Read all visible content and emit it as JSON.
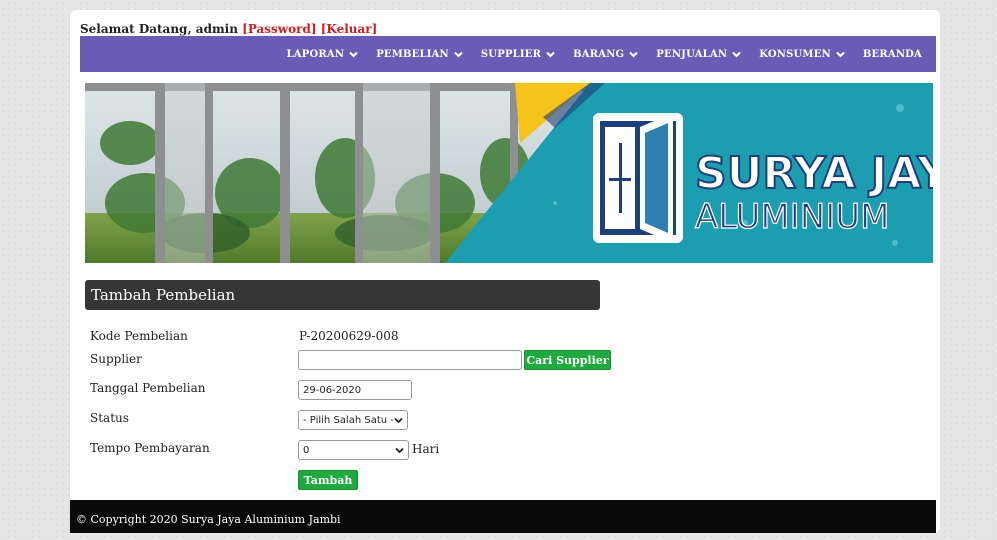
{
  "header": {
    "welcome_text": "Selamat Datang, admin",
    "password_link": "[Password]",
    "logout_link": "[Keluar]"
  },
  "nav": {
    "items": [
      "LAPORAN",
      "PEMBELIAN",
      "SUPPLIER",
      "BARANG",
      "PENJUALAN",
      "KONSUMEN",
      "BERANDA"
    ]
  },
  "banner": {
    "brand_line1": "SURYA JAYA",
    "brand_line2": "ALUMINIUM",
    "colors": {
      "teal": "#1c9db0",
      "yellow": "#f6c21c",
      "navy": "#1d3f7a"
    }
  },
  "form": {
    "title": "Tambah Pembelian",
    "kode_label": "Kode Pembelian",
    "kode_value": "P-20200629-008",
    "supplier_label": "Supplier",
    "supplier_value": "",
    "cari_button": "Cari Supplier",
    "tanggal_label": "Tanggal Pembelian",
    "tanggal_value": "29-06-2020",
    "status_label": "Status",
    "status_value": "- Pilih Salah Satu -",
    "tempo_label": "Tempo Pembayaran",
    "tempo_value": "0",
    "tempo_unit": "Hari",
    "submit_button": "Tambah"
  },
  "footer": {
    "text": "© Copyright 2020 Surya Jaya Aluminium Jambi"
  }
}
